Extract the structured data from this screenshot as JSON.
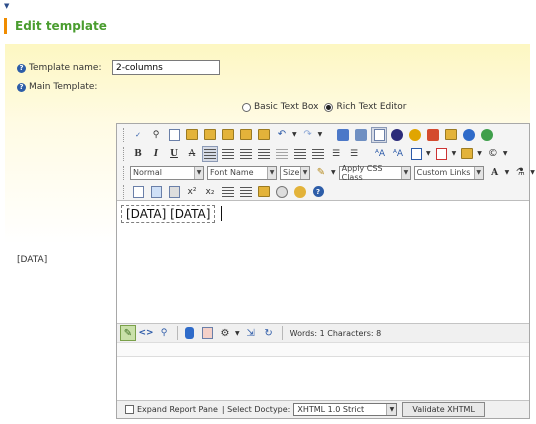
{
  "page": {
    "title": "Edit template"
  },
  "form": {
    "template_name_label": "Template name:",
    "template_name_value": "2-columns",
    "main_template_label": "Main Template:",
    "side_label": "[DATA]"
  },
  "mode": {
    "basic_label": "Basic Text Box",
    "rich_label": "Rich Text Editor",
    "selected": "Rich Text Editor"
  },
  "toolbar": {
    "format_select": "Normal",
    "font_select": "Font Name",
    "size_select": "Size",
    "css_select": "Apply CSS Class",
    "links_select": "Custom Links",
    "font_color_glyph": "A",
    "superscript_glyph": "x²",
    "subscript_glyph": "x₂"
  },
  "editor": {
    "content": "[DATA] [DATA]",
    "status": "Words: 1 Characters: 8"
  },
  "footer": {
    "expand_label": "Expand Report Pane",
    "doctype_label": "| Select Doctype:",
    "doctype_value": "XHTML 1.0 Strict",
    "validate_label": "Validate XHTML"
  },
  "colors": {
    "title_green": "#4a9d2f",
    "accent_orange": "#f08c00",
    "panel_yellow": "#fdf7c2"
  }
}
